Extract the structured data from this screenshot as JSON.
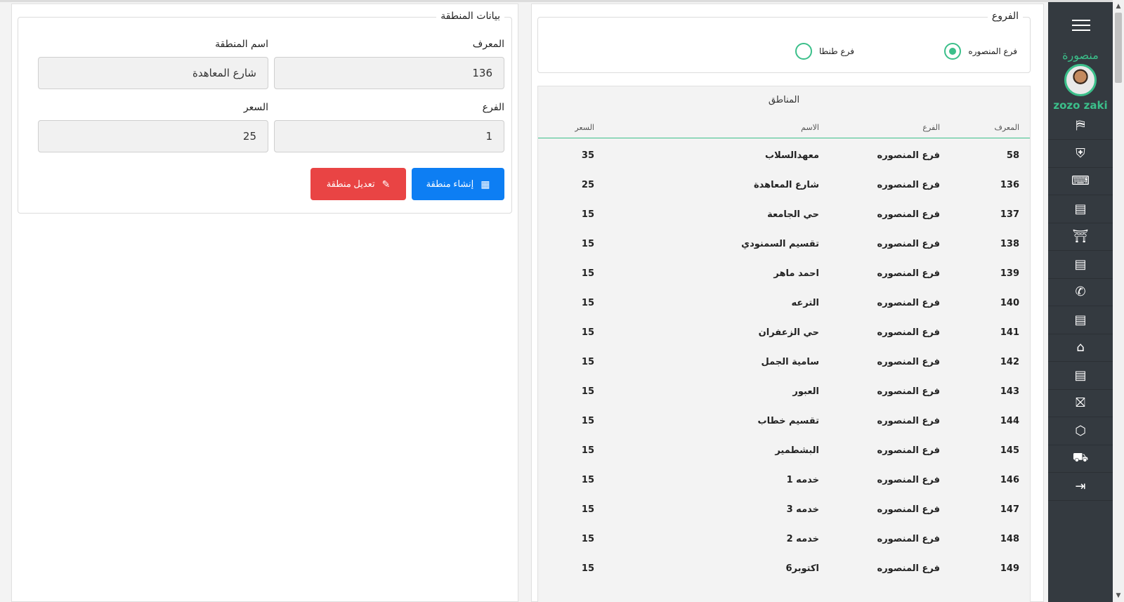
{
  "sidebar": {
    "brand": "منصورة",
    "username": "zozo zaki",
    "items": [
      {
        "icon": "signpost-icon",
        "glyph": "⛿"
      },
      {
        "icon": "shield-icon",
        "glyph": "⛨"
      },
      {
        "icon": "cash-register-icon",
        "glyph": "⌨"
      },
      {
        "icon": "receipt-icon",
        "glyph": "▤"
      },
      {
        "icon": "table-icon",
        "glyph": "⛩"
      },
      {
        "icon": "receipt-icon",
        "glyph": "▤"
      },
      {
        "icon": "phone-icon",
        "glyph": "✆"
      },
      {
        "icon": "receipt-icon",
        "glyph": "▤"
      },
      {
        "icon": "home-icon",
        "glyph": "⌂"
      },
      {
        "icon": "receipt-icon",
        "glyph": "▤"
      },
      {
        "icon": "gift-icon",
        "glyph": "⛝"
      },
      {
        "icon": "box-search-icon",
        "glyph": "⬡"
      },
      {
        "icon": "scooter-icon",
        "glyph": "⛟"
      },
      {
        "icon": "logout-icon",
        "glyph": "⇥"
      }
    ]
  },
  "branches": {
    "legend": "الفروع",
    "options": [
      {
        "label": "فرع المنصوره",
        "checked": true
      },
      {
        "label": "فرع طنطا",
        "checked": false
      }
    ]
  },
  "zones_table": {
    "caption": "المناطق",
    "headers": {
      "id": "المعرف",
      "branch": "الفرع",
      "name": "الاسم",
      "price": "السعر"
    },
    "rows": [
      {
        "id": "58",
        "branch": "فرع المنصوره",
        "name": "معهدالسلاب",
        "price": "35"
      },
      {
        "id": "136",
        "branch": "فرع المنصوره",
        "name": "شارع المعاهدة",
        "price": "25"
      },
      {
        "id": "137",
        "branch": "فرع المنصوره",
        "name": "حي الجامعة",
        "price": "15"
      },
      {
        "id": "138",
        "branch": "فرع المنصوره",
        "name": "تقسيم السمنودي",
        "price": "15"
      },
      {
        "id": "139",
        "branch": "فرع المنصوره",
        "name": "احمد ماهر",
        "price": "15"
      },
      {
        "id": "140",
        "branch": "فرع المنصوره",
        "name": "الترعه",
        "price": "15"
      },
      {
        "id": "141",
        "branch": "فرع المنصوره",
        "name": "حي الزعفران",
        "price": "15"
      },
      {
        "id": "142",
        "branch": "فرع المنصوره",
        "name": "سامية الجمل",
        "price": "15"
      },
      {
        "id": "143",
        "branch": "فرع المنصوره",
        "name": "العبور",
        "price": "15"
      },
      {
        "id": "144",
        "branch": "فرع المنصوره",
        "name": "تقسيم خطاب",
        "price": "15"
      },
      {
        "id": "145",
        "branch": "فرع المنصوره",
        "name": "البشطمير",
        "price": "15"
      },
      {
        "id": "146",
        "branch": "فرع المنصوره",
        "name": "خدمه 1",
        "price": "15"
      },
      {
        "id": "147",
        "branch": "فرع المنصوره",
        "name": "خدمه 3",
        "price": "15"
      },
      {
        "id": "148",
        "branch": "فرع المنصوره",
        "name": "خدمه 2",
        "price": "15"
      },
      {
        "id": "149",
        "branch": "فرع المنصوره",
        "name": "6اكتوبر",
        "price": "15"
      }
    ]
  },
  "zone_form": {
    "legend": "بيانات المنطقة",
    "id_label": "المعرف",
    "id_value": "136",
    "name_label": "اسم المنطقة",
    "name_value": "شارع المعاهدة",
    "branch_label": "الفرع",
    "branch_value": "1",
    "price_label": "السعر",
    "price_value": "25",
    "create_label": "إنشاء منطقة",
    "edit_label": "تعديل منطقة"
  }
}
